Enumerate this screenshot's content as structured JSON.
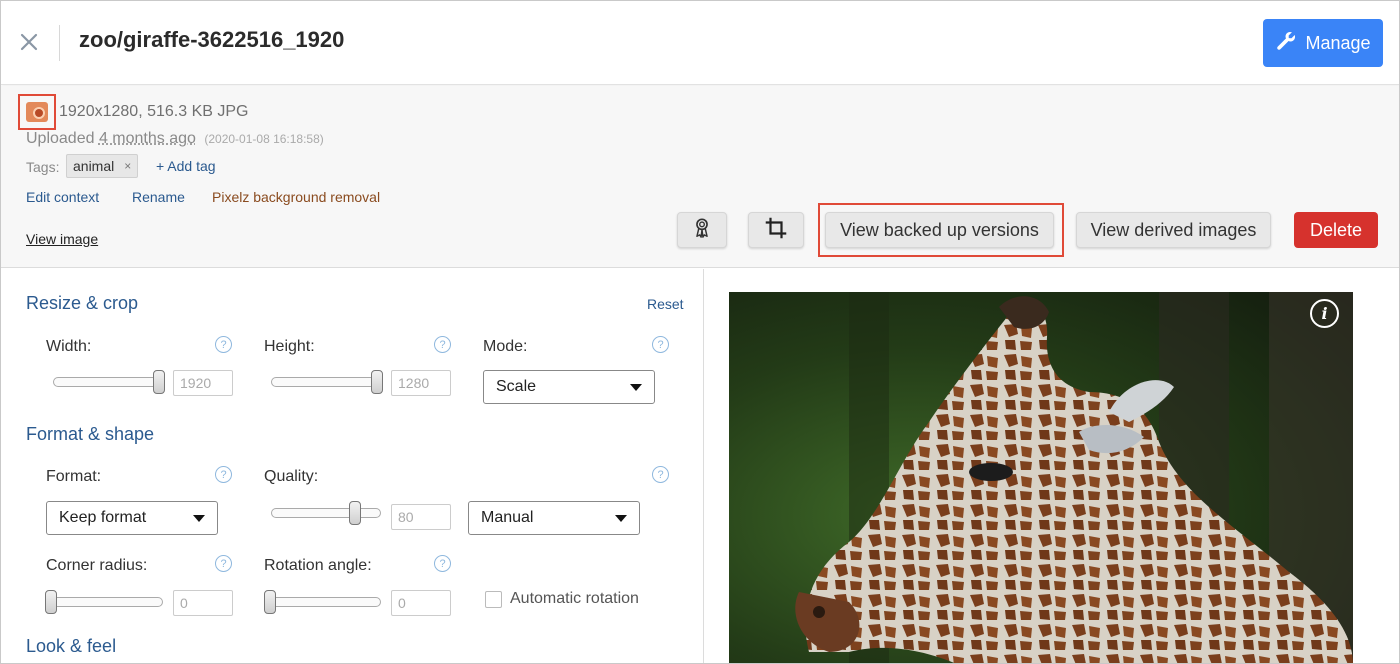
{
  "header": {
    "title": "zoo/giraffe-3622516_1920",
    "manage_label": "Manage"
  },
  "info": {
    "dimensions": "1920x1280, 516.3 KB JPG",
    "uploaded_prefix": "Uploaded",
    "uploaded_ago": "4 months ago",
    "uploaded_timestamp": "(2020-01-08 16:18:58)",
    "tags_label": "Tags:",
    "tags": [
      "animal"
    ],
    "tag_remove": "×",
    "add_tag_label": "+ Add tag",
    "links": {
      "edit_context": "Edit context",
      "rename": "Rename",
      "pixelz": "Pixelz background removal"
    },
    "view_image": "View image",
    "buttons": {
      "view_backed_up": "View backed up versions",
      "view_derived": "View derived images",
      "delete": "Delete"
    }
  },
  "panel": {
    "resize_crop": {
      "title": "Resize & crop",
      "reset": "Reset",
      "width_label": "Width:",
      "width_value": "1920",
      "width_slider": 1.0,
      "height_label": "Height:",
      "height_value": "1280",
      "height_slider": 1.0,
      "mode_label": "Mode:",
      "mode_value": "Scale"
    },
    "format_shape": {
      "title": "Format & shape",
      "format_label": "Format:",
      "format_value": "Keep format",
      "quality_label": "Quality:",
      "quality_value": "80",
      "quality_slider": 0.8,
      "quality_mode": "Manual",
      "corner_label": "Corner radius:",
      "corner_value": "0",
      "corner_slider": 0,
      "rotation_label": "Rotation angle:",
      "rotation_value": "0",
      "rotation_slider": 0,
      "auto_rotation_label": "Automatic rotation"
    },
    "look_feel": {
      "title": "Look & feel"
    },
    "help_glyph": "?"
  },
  "preview": {
    "info_glyph": "i"
  },
  "colors": {
    "primary": "#3a84f7",
    "delete": "#d6322d",
    "link": "#2b5a8f",
    "highlight": "#e04a38"
  }
}
